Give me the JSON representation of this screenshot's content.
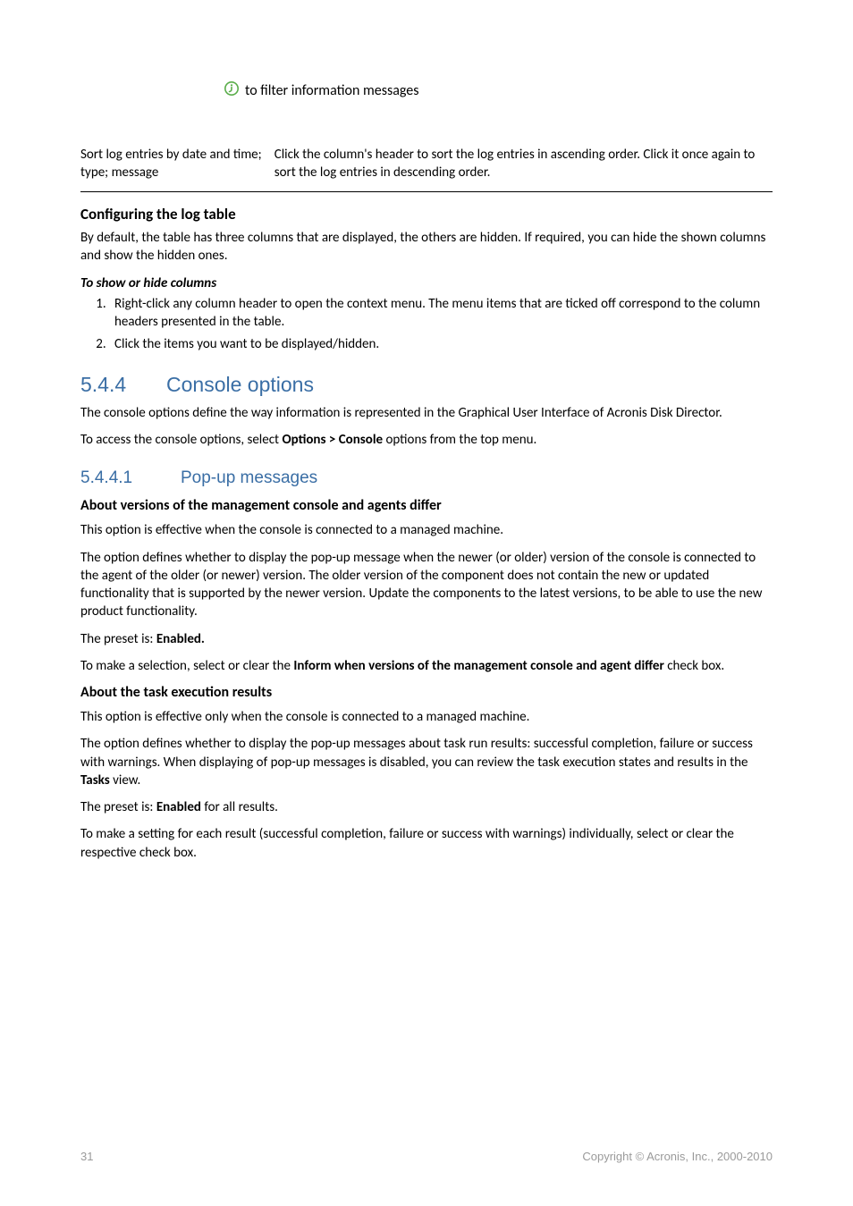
{
  "info_line": " to filter information messages",
  "sort_row": {
    "left": "Sort log entries by date and time; type; message",
    "right": "Click the column's header to sort the log entries in ascending order. Click it once again to sort the log entries in descending order."
  },
  "config_heading": "Configuring the log table",
  "config_body": "By default, the table has three columns that are displayed, the others are hidden. If required, you can hide the shown columns and show the hidden ones.",
  "show_hide_heading": "To show or hide columns",
  "show_hide_items": [
    "Right-click any column header to open the context menu. The menu items that are ticked off correspond to the column headers presented in the table.",
    "Click the items you want to be displayed/hidden."
  ],
  "section": {
    "num": "5.4.4",
    "title": "Console options"
  },
  "section_body1": "The console options define the way information is represented in the Graphical User Interface of Acronis Disk Director.",
  "section_body2_pre": "To access the console options, select ",
  "section_body2_bold": "Options > Console",
  "section_body2_post": " options from the top menu.",
  "subsection": {
    "num": "5.4.4.1",
    "title": "Pop-up messages"
  },
  "about1_heading": "About versions of the management console and agents differ",
  "about1_p1": "This option is effective when the console is connected to a managed machine.",
  "about1_p2": "The option defines whether to display the pop-up message when the newer (or older) version of the console is connected to the agent of the older (or newer) version. The older version of the component does not contain the new or updated functionality that is supported by the newer version. Update the components to the latest versions, to be able to use the new product functionality.",
  "preset_label": "The preset is: ",
  "preset_enabled": "Enabled.",
  "about1_p4_pre": "To make a selection, select or clear the ",
  "about1_p4_bold": "Inform when versions of the management console and agent differ",
  "about1_p4_post": " check box.",
  "about2_heading": "About the task execution results",
  "about2_p1": "This option is effective only when the console is connected to a managed machine.",
  "about2_p2_pre": "The option defines whether to display the pop-up messages about task run results: successful completion, failure or success with warnings. When displaying of pop-up messages is disabled, you can review the task execution states and results in the ",
  "about2_p2_bold": "Tasks",
  "about2_p2_post": " view.",
  "about2_preset_pre": "The preset is: ",
  "about2_preset_bold": "Enabled",
  "about2_preset_post": " for all results.",
  "about2_p4": "To make a setting for each result (successful completion, failure or success with warnings) individually, select or clear the respective check box.",
  "footer": {
    "page": "31",
    "copyright": "Copyright © Acronis, Inc., 2000-2010"
  }
}
